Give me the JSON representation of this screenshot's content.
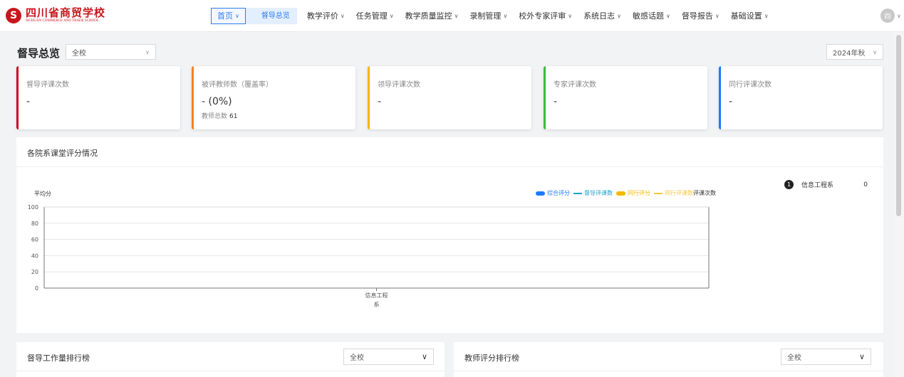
{
  "logo": {
    "mark": "S",
    "cn": "四川省商贸学校",
    "en": "SICHUAN COMMERCE AND TRADE SCHOOL"
  },
  "nav": {
    "home": "首页",
    "active": "督导总览",
    "items": [
      "教学评价",
      "任务管理",
      "教学质量监控",
      "录制管理",
      "校外专家评审",
      "系统日志",
      "敏感话题",
      "督导报告",
      "基础设置"
    ]
  },
  "user": {
    "avatar": "四"
  },
  "page": {
    "title": "督导总览",
    "scope_select": "全校",
    "term_select": "2024年秋"
  },
  "cards": [
    {
      "label": "督导评课次数",
      "value": "-",
      "color": "#d0021b"
    },
    {
      "label": "被评教师数（覆盖率）",
      "value": "-  (0%)",
      "sub_label": "教师总数",
      "sub_value": "61",
      "color": "#f5821f"
    },
    {
      "label": "领导评课次数",
      "value": "-",
      "color": "#f5b800"
    },
    {
      "label": "专家评课次数",
      "value": "-",
      "color": "#3dba3d"
    },
    {
      "label": "同行评课次数",
      "value": "-",
      "color": "#1e7bff"
    }
  ],
  "dept_panel": {
    "title": "各院系课堂评分情况"
  },
  "chart_data": {
    "type": "line",
    "title": "",
    "xlabel": "",
    "ylabel": "平均分",
    "ylim": [
      0,
      100
    ],
    "yticks": [
      0,
      20,
      40,
      60,
      80,
      100
    ],
    "categories": [
      "信息工程系"
    ],
    "series": [
      {
        "name": "综合评分",
        "color": "#1e7bff",
        "values": [
          0
        ]
      },
      {
        "name": "督导评课数",
        "color": "#1aa3c9",
        "values": [
          0
        ]
      },
      {
        "name": "同行评分",
        "color": "#f5b800",
        "values": [
          0
        ]
      },
      {
        "name": "同行评课数",
        "color": "#f5c842",
        "values": [
          0
        ]
      }
    ],
    "legend_tail": "评课次数",
    "legend": "top-right",
    "grid": true
  },
  "ranking": [
    {
      "rank": "1",
      "name": "信息工程系",
      "value": "0"
    }
  ],
  "bottom": {
    "left": {
      "title": "督导工作量排行榜",
      "select": "全校"
    },
    "right": {
      "title": "教师评分排行榜",
      "select": "全校"
    }
  },
  "colors": {
    "accent": "#2d7cf6",
    "brand": "#c8161d"
  }
}
